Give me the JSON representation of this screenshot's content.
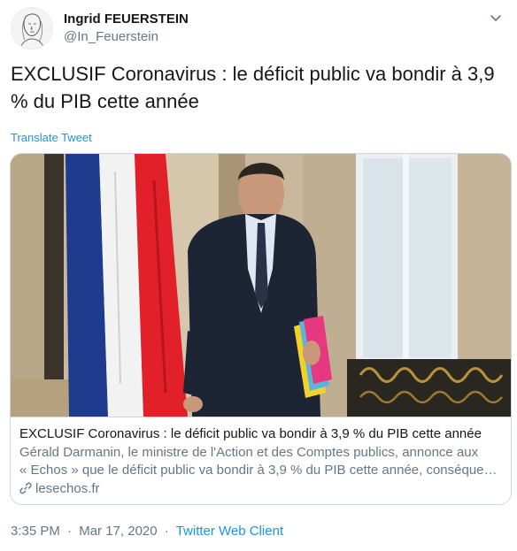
{
  "author": {
    "name": "Ingrid FEUERSTEIN",
    "handle": "@In_Feuerstein",
    "avatar_icon": "avatar-sketch-icon"
  },
  "menu_icon": "chevron-down-icon",
  "tweet": {
    "text": "EXCLUSIF Coronavirus : le déficit public va bondir à 3,9 % du PIB cette année",
    "translate_label": "Translate Tweet"
  },
  "card": {
    "title": "EXCLUSIF Coronavirus : le déficit public va bondir à 3,9 % du PIB cette année",
    "description_line1": "Gérald Darmanin, le ministre de l'Action et des Comptes publics, annonce aux",
    "description_line2": "« Echos » que le déficit public va bondir à 3,9 % du PIB cette année, conséquence",
    "domain": "lesechos.fr",
    "link_icon": "link-icon"
  },
  "meta": {
    "time": "3:35 PM",
    "separator1": "·",
    "date": "Mar 17, 2020",
    "separator2": "·",
    "source": "Twitter Web Client"
  },
  "colors": {
    "link_blue": "#1b95e0",
    "secondary_gray": "#657786",
    "text_dark": "#14171a",
    "border": "#ccd6dd"
  }
}
